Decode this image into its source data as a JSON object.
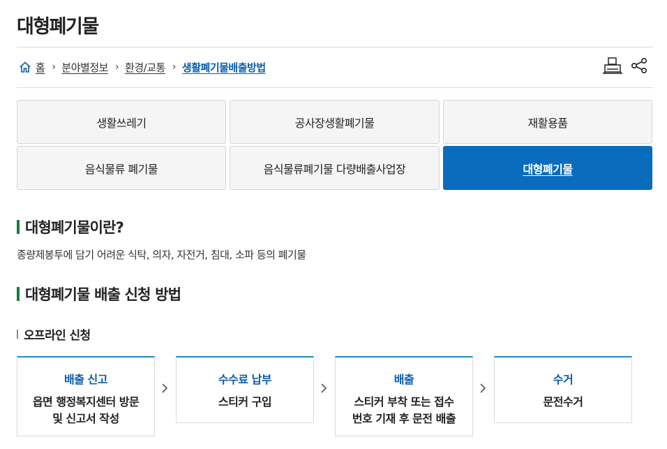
{
  "page": {
    "title": "대형폐기물"
  },
  "breadcrumb": {
    "items": [
      {
        "label": "홈"
      },
      {
        "label": "분야별정보"
      },
      {
        "label": "환경/교통"
      },
      {
        "label": "생활폐기물배출방법"
      }
    ],
    "separator": "›"
  },
  "tools": {
    "print_icon": "printer-icon",
    "share_icon": "share-icon"
  },
  "tabs": [
    {
      "label": "생활쓰레기"
    },
    {
      "label": "공사장생활폐기물"
    },
    {
      "label": "재활용품"
    },
    {
      "label": "음식물류 폐기물"
    },
    {
      "label": "음식물류폐기물 다량배출사업장"
    },
    {
      "label": "대형폐기물",
      "active": true
    }
  ],
  "sections": {
    "what": {
      "title": "대형폐기물이란?",
      "description": "종량제봉투에 담기 어려운 식탁, 의자, 자전거, 침대, 소파 등의 폐기물"
    },
    "how": {
      "title": "대형폐기물 배출 신청 방법",
      "offline": {
        "title": "오프라인 신청",
        "steps": [
          {
            "title": "배출 신고",
            "desc": "읍면 행정복지센터 방문\n및 신고서 작성"
          },
          {
            "title": "수수료 납부",
            "desc": "스티커 구입"
          },
          {
            "title": "배출",
            "desc": "스티커 부착 또는 접수\n번호 기재 후 문전 배출"
          },
          {
            "title": "수거",
            "desc": "문전수거"
          }
        ],
        "arrow_icon": "chevron-right-icon"
      }
    }
  },
  "colors": {
    "accent": "#0a6cbd",
    "link_current": "#0a5dab",
    "section_bar": "#1d7a3c",
    "step_top_border": "#1f8cc0"
  }
}
